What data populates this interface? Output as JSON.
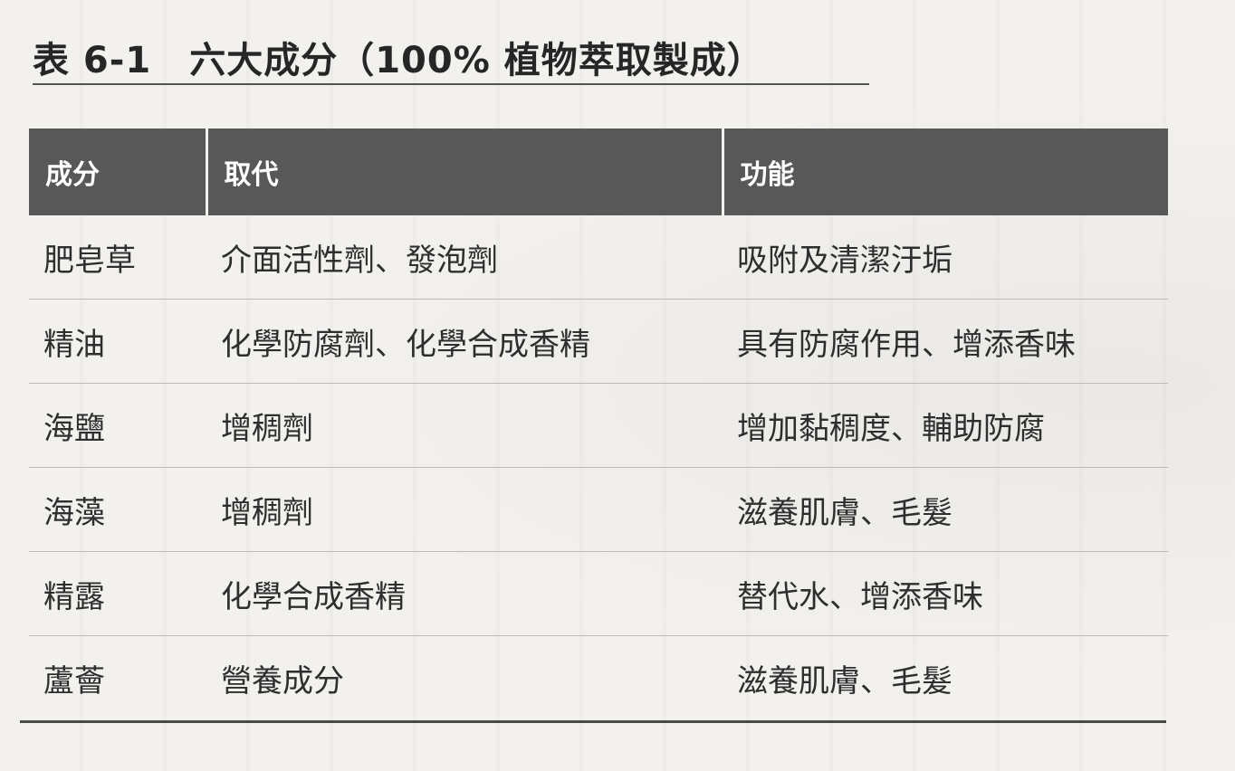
{
  "table": {
    "number": "表 6-1",
    "title": "六大成分（100% 植物萃取製成）",
    "headers": [
      "成分",
      "取代",
      "功能"
    ],
    "rows": [
      [
        "肥皂草",
        "介面活性劑、發泡劑",
        "吸附及清潔汙垢"
      ],
      [
        "精油",
        "化學防腐劑、化學合成香精",
        "具有防腐作用、增添香味"
      ],
      [
        "海鹽",
        "增稠劑",
        "增加黏稠度、輔助防腐"
      ],
      [
        "海藻",
        "增稠劑",
        "滋養肌膚、毛髮"
      ],
      [
        "精露",
        "化學合成香精",
        "替代水、增添香味"
      ],
      [
        "蘆薈",
        "營養成分",
        "滋養肌膚、毛髮"
      ]
    ]
  },
  "colors": {
    "header_background": "#585858",
    "header_text": "#ffffff",
    "page_background": "#f3f1ee",
    "row_divider": "#bdbab5"
  }
}
